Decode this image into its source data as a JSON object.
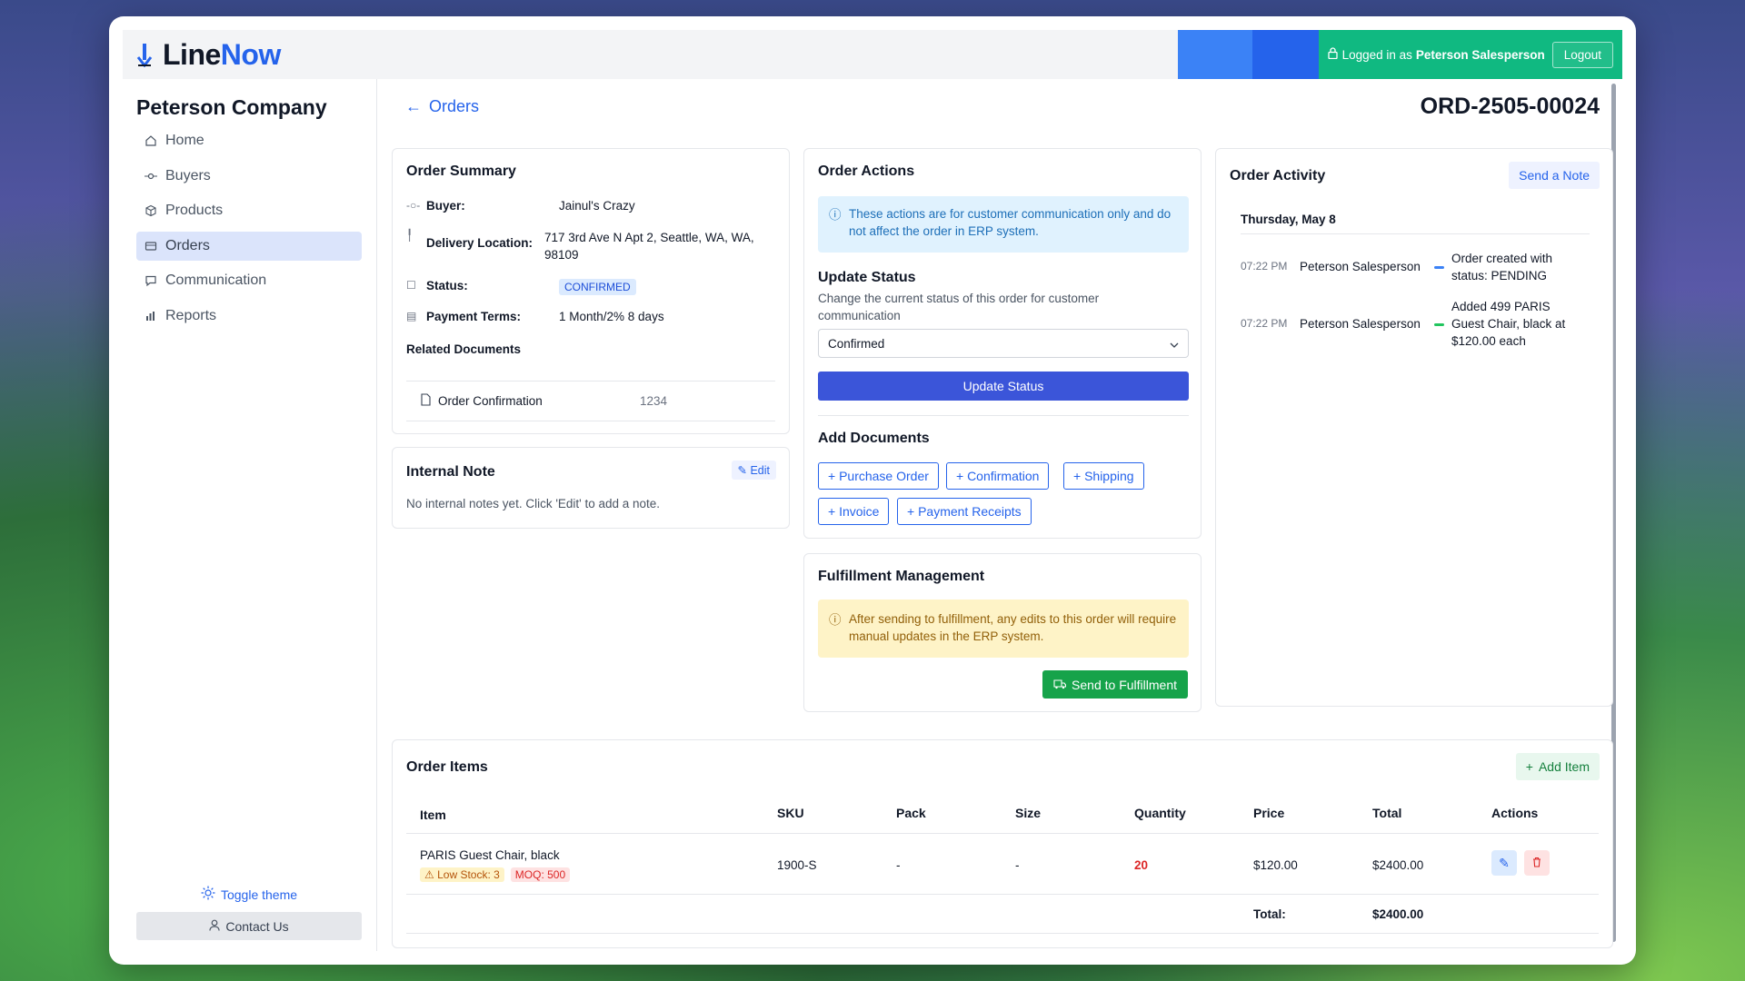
{
  "app": {
    "logo_a": "Line",
    "logo_b": "Now"
  },
  "auth": {
    "prefix": "Logged in as",
    "user": "Peterson Salesperson",
    "logout": "Logout"
  },
  "sidebar": {
    "company": "Peterson Company",
    "items": [
      {
        "label": "Home",
        "icon": "home-icon"
      },
      {
        "label": "Buyers",
        "icon": "buyers-icon"
      },
      {
        "label": "Products",
        "icon": "box-icon"
      },
      {
        "label": "Orders",
        "icon": "orders-icon",
        "active": true
      },
      {
        "label": "Communication",
        "icon": "message-icon"
      },
      {
        "label": "Reports",
        "icon": "chart-icon"
      }
    ],
    "toggle_theme": "Toggle theme",
    "contact": "Contact Us"
  },
  "header": {
    "back": "Orders",
    "order_number": "ORD-2505-00024"
  },
  "summary": {
    "title": "Order Summary",
    "buyer_label": "Buyer:",
    "buyer": "Jainul's Crazy",
    "location_label": "Delivery Location:",
    "location": "717 3rd Ave N Apt 2, Seattle, WA, WA, 98109",
    "status_label": "Status:",
    "status": "CONFIRMED",
    "terms_label": "Payment Terms:",
    "terms": "1 Month/2% 8 days",
    "related_title": "Related Documents",
    "doc_name": "Order Confirmation",
    "doc_num": "1234"
  },
  "note": {
    "title": "Internal Note",
    "edit": "Edit",
    "text": "No internal notes yet. Click 'Edit' to add a note."
  },
  "actions": {
    "title": "Order Actions",
    "info": "These actions are for customer communication only and do not affect the order in ERP system.",
    "update_title": "Update Status",
    "update_desc": "Change the current status of this order for customer communication",
    "select_value": "Confirmed",
    "update_btn": "Update Status",
    "docs_title": "Add Documents",
    "docs": [
      "+ Purchase Order",
      "+ Confirmation",
      "+ Shipping",
      "+ Invoice",
      "+ Payment Receipts"
    ]
  },
  "fulfillment": {
    "title": "Fulfillment Management",
    "warning": "After sending to fulfillment, any edits to this order will require manual updates in the ERP system.",
    "send": "Send to Fulfillment"
  },
  "activity": {
    "title": "Order Activity",
    "send_note": "Send a Note",
    "date": "Thursday, May 8",
    "entries": [
      {
        "time": "07:22 PM",
        "user": "Peterson Salesperson",
        "text": "Order created with status: PENDING",
        "color": "#3b82f6"
      },
      {
        "time": "07:22 PM",
        "user": "Peterson Salesperson",
        "text": "Added 499 PARIS Guest Chair, black at $120.00 each",
        "color": "#22c55e"
      }
    ]
  },
  "items": {
    "title": "Order Items",
    "add": "Add Item",
    "headers": [
      "Item",
      "SKU",
      "Pack",
      "Size",
      "Quantity",
      "Price",
      "Total",
      "Actions"
    ],
    "row": {
      "name": "PARIS Guest Chair, black",
      "low": "Low Stock: 3",
      "moq": "MOQ: 500",
      "sku": "1900-S",
      "pack": "-",
      "size": "-",
      "qty": "20",
      "price": "$120.00",
      "total": "$2400.00"
    },
    "total_label": "Total:",
    "total_value": "$2400.00"
  }
}
